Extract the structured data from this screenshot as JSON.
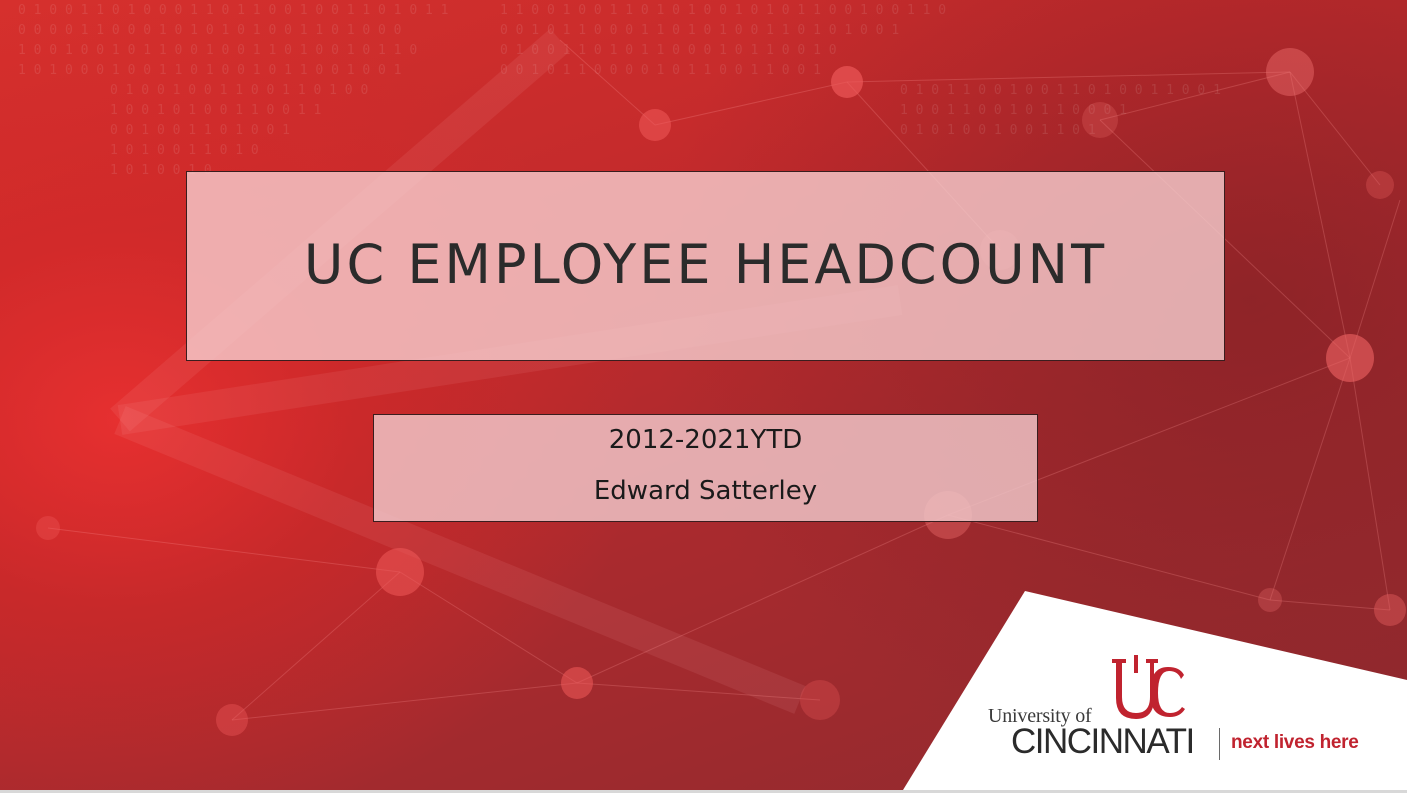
{
  "slide": {
    "title": "UC EMPLOYEE HEADCOUNT",
    "subtitle_line1": "2012-2021YTD",
    "subtitle_line2": "Edward Satterley"
  },
  "logo": {
    "university_of": "University of",
    "cincinnati": "CINCINNATI",
    "tagline": "next lives here",
    "brand_color": "#c0232f"
  },
  "colors": {
    "background_red": "#c22a2c",
    "box_fill": "#f6ced0"
  }
}
